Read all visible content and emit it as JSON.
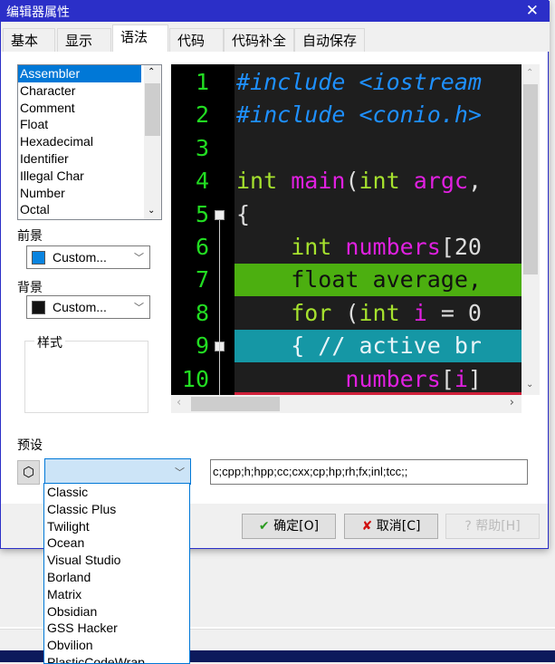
{
  "window": {
    "title": "编辑器属性",
    "close_icon": "close-icon"
  },
  "tabs": [
    {
      "label": "基本"
    },
    {
      "label": "显示"
    },
    {
      "label": "语法",
      "active": true
    },
    {
      "label": "代码"
    },
    {
      "label": "代码补全"
    },
    {
      "label": "自动保存"
    }
  ],
  "syntax_list": {
    "selected": "Assembler",
    "items": [
      "Assembler",
      "Character",
      "Comment",
      "Float",
      "Hexadecimal",
      "Identifier",
      "Illegal Char",
      "Number",
      "Octal"
    ]
  },
  "foreground": {
    "label": "前景",
    "value": "Custom...",
    "color": "#0a84e0"
  },
  "background": {
    "label": "背景",
    "value": "Custom...",
    "color": "#111111"
  },
  "style_group": {
    "label": "样式"
  },
  "preview": {
    "lines": [
      {
        "n": "1",
        "parts": [
          [
            "#include <iostream",
            "#1e90ff",
            "i"
          ]
        ]
      },
      {
        "n": "2",
        "parts": [
          [
            "#include <conio.h>",
            "#1e90ff",
            "i"
          ]
        ]
      },
      {
        "n": "3",
        "parts": []
      },
      {
        "n": "4",
        "parts": [
          [
            "int ",
            "#a6e22e"
          ],
          [
            "main",
            "#e020e0"
          ],
          [
            "(",
            "#ddd"
          ],
          [
            "int ",
            "#a6e22e"
          ],
          [
            "argc",
            "#e020e0"
          ],
          [
            ",",
            "#ddd"
          ]
        ]
      },
      {
        "n": "5",
        "parts": [
          [
            "{",
            "#ddd"
          ]
        ],
        "fold": true
      },
      {
        "n": "6",
        "parts": [
          [
            "    int ",
            "#a6e22e"
          ],
          [
            "numbers",
            "#e020e0"
          ],
          [
            "[20",
            "#ddd"
          ]
        ]
      },
      {
        "n": "7",
        "parts": [
          [
            "    float average,",
            "#111"
          ]
        ],
        "bg": "#4caf10"
      },
      {
        "n": "8",
        "parts": [
          [
            "    for ",
            "#a6e22e"
          ],
          [
            "(",
            "#ddd"
          ],
          [
            "int ",
            "#a6e22e"
          ],
          [
            "i",
            "#e020e0"
          ],
          [
            " = 0",
            "#ddd"
          ]
        ]
      },
      {
        "n": "9",
        "parts": [
          [
            "    { // active br",
            "#e8f4f8"
          ]
        ],
        "bg": "#1597a5",
        "fold": true
      },
      {
        "n": "10",
        "parts": [
          [
            "        ",
            "#ddd"
          ],
          [
            "numbers",
            "#e020e0"
          ],
          [
            "[",
            "#ddd"
          ],
          [
            "i",
            "#e020e0"
          ],
          [
            "]",
            "#ddd"
          ]
        ]
      }
    ]
  },
  "presets": {
    "label": "预设",
    "selected": "",
    "extensions": "c;cpp;h;hpp;cc;cxx;cp;hp;rh;fx;inl;tcc;;",
    "options": [
      "Classic",
      "Classic Plus",
      "Twilight",
      "Ocean",
      "Visual Studio",
      "Borland",
      "Matrix",
      "Obsidian",
      "GSS Hacker",
      "Obvilion",
      "PlasticCodeWrap"
    ]
  },
  "buttons": {
    "ok": "确定[O]",
    "cancel": "取消[C]",
    "help": "帮助[H]"
  }
}
